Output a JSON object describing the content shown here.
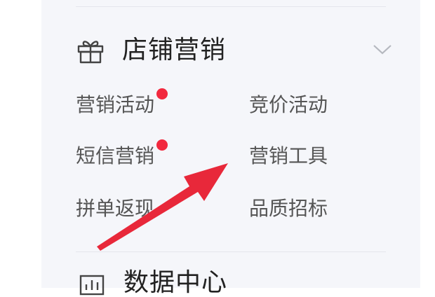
{
  "section": {
    "title": "店铺营销",
    "icon": "gift-icon",
    "expanded": true
  },
  "menu": {
    "items": [
      {
        "label": "营销活动",
        "badge": true
      },
      {
        "label": "竞价活动",
        "badge": false
      },
      {
        "label": "短信营销",
        "badge": true
      },
      {
        "label": "营销工具",
        "badge": false
      },
      {
        "label": "拼单返现",
        "badge": false
      },
      {
        "label": "品质招标",
        "badge": false
      }
    ]
  },
  "next_section": {
    "title": "数据中心",
    "icon": "data-icon"
  },
  "colors": {
    "badge": "#f2293e",
    "annotation_arrow": "#e8283a",
    "panel_bg": "#f5f6fa"
  }
}
